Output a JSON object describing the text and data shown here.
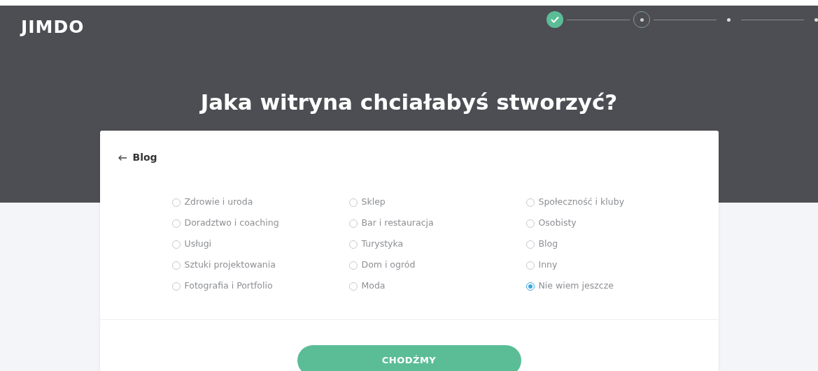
{
  "header": {
    "logo": "JIMDO",
    "steps": [
      {
        "kind": "done"
      },
      {
        "kind": "current"
      },
      {
        "kind": "pending"
      },
      {
        "kind": "pending"
      }
    ]
  },
  "title": "Jaka witryna chciałabyś stworzyć?",
  "card": {
    "back_label": "Blog",
    "options": [
      [
        {
          "label": "Zdrowie i uroda",
          "selected": false
        },
        {
          "label": "Doradztwo i coaching",
          "selected": false
        },
        {
          "label": "Usługi",
          "selected": false
        },
        {
          "label": "Sztuki projektowania",
          "selected": false
        },
        {
          "label": "Fotografia i Portfolio",
          "selected": false
        }
      ],
      [
        {
          "label": "Sklep",
          "selected": false
        },
        {
          "label": "Bar i restauracja",
          "selected": false
        },
        {
          "label": "Turystyka",
          "selected": false
        },
        {
          "label": "Dom i ogród",
          "selected": false
        },
        {
          "label": "Moda",
          "selected": false
        }
      ],
      [
        {
          "label": "Społeczność i kluby",
          "selected": false
        },
        {
          "label": "Osobisty",
          "selected": false
        },
        {
          "label": "Blog",
          "selected": false
        },
        {
          "label": "Inny",
          "selected": false
        },
        {
          "label": "Nie wiem jeszcze",
          "selected": true
        }
      ]
    ],
    "button": "CHODŹMY"
  }
}
